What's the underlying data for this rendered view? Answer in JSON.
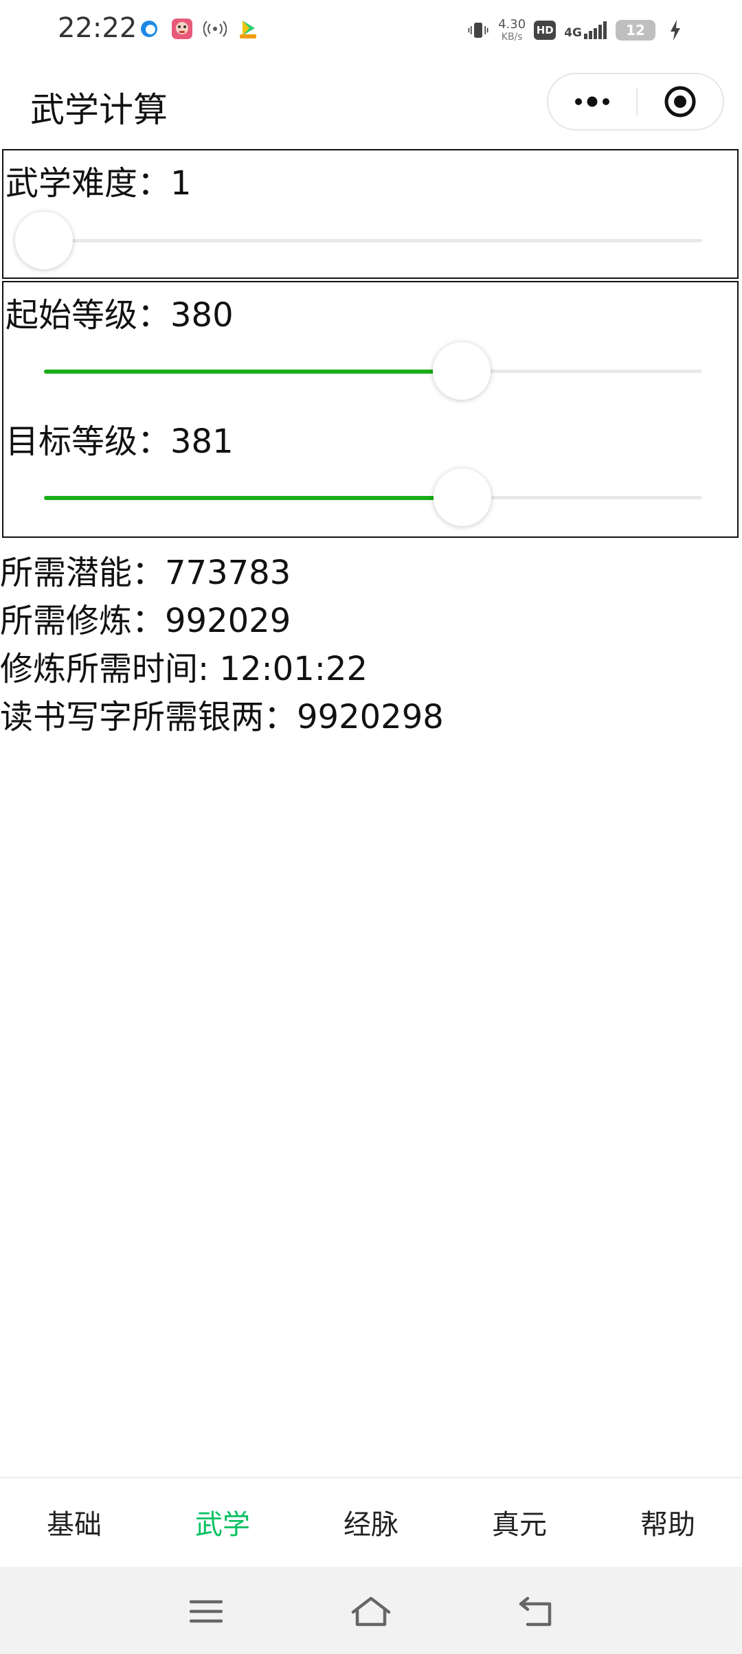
{
  "status_bar": {
    "time": "22:22",
    "net_speed_value": "4.30",
    "net_speed_unit": "KB/s",
    "hd": "HD",
    "network_type": "4G",
    "battery": "12",
    "icons": [
      "browser-icon",
      "avatar-app-icon",
      "hotspot-icon",
      "video-app-icon",
      "vibrate-icon",
      "signal-icon",
      "charging-icon"
    ]
  },
  "nav": {
    "title": "武学计算"
  },
  "difficulty": {
    "label": "武学难度：1",
    "value": 1,
    "slider_fraction": 0.0
  },
  "levels": {
    "start_label": "起始等级：380",
    "start_value": 380,
    "start_fraction": 0.635,
    "target_label": "目标等级：381",
    "target_value": 381,
    "target_fraction": 0.636
  },
  "results": {
    "potential": "所需潜能：773783",
    "cultivation": "所需修炼：992029",
    "cultivation_time": "修炼所需时间: 12:01:22",
    "silver": "读书写字所需银两：9920298"
  },
  "tabs": [
    {
      "label": "基础",
      "active": false
    },
    {
      "label": "武学",
      "active": true
    },
    {
      "label": "经脉",
      "active": false
    },
    {
      "label": "真元",
      "active": false
    },
    {
      "label": "帮助",
      "active": false
    }
  ],
  "colors": {
    "accent_green": "#07c160",
    "slider_green": "#1aad19"
  }
}
